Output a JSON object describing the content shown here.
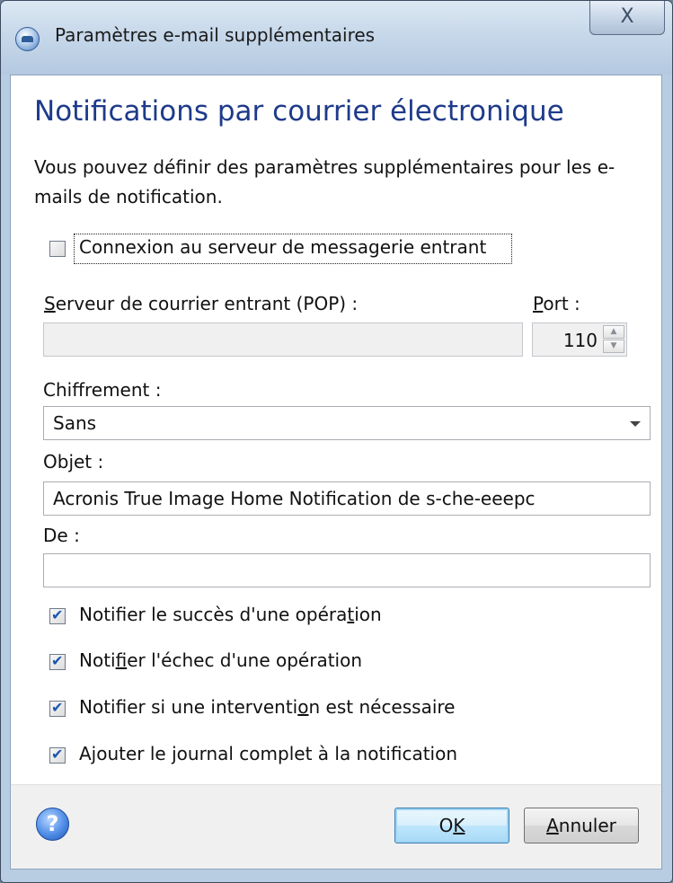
{
  "window": {
    "title": "Paramètres e-mail supplémentaires",
    "close_label": "X"
  },
  "heading": "Notifications par courrier électronique",
  "description": "Vous pouvez définir des paramètres supplémentaires pour les e-mails de notification.",
  "incoming_login": {
    "label": "Connexion au serveur de messagerie entrant",
    "checked": false
  },
  "pop": {
    "server_label_key": "S",
    "server_label_rest": "erveur de courrier entrant (POP) :",
    "server_value": "",
    "port_label_key": "P",
    "port_label_rest": "ort :",
    "port_value": "110"
  },
  "encryption": {
    "label": "Chiffrement :",
    "value": "Sans"
  },
  "subject": {
    "label": "Objet :",
    "value": "Acronis True Image Home Notification de s-che-eeepc"
  },
  "from": {
    "label": "De :",
    "value": ""
  },
  "options": [
    {
      "pre": "Notifier le succès d'une opéra",
      "key": "t",
      "post": "ion",
      "checked": true
    },
    {
      "pre": "Noti",
      "key": "f",
      "post": "ier l'échec d'une opération",
      "checked": true
    },
    {
      "pre": "Notifier si une interventi",
      "key": "o",
      "post": "n est nécessaire",
      "checked": true
    },
    {
      "pre": "Ajouter le ",
      "key": "j",
      "post": "ournal complet à la notification",
      "checked": true
    }
  ],
  "buttons": {
    "ok_pre": "O",
    "ok_key": "K",
    "cancel_key": "A",
    "cancel_rest": "nnuler"
  },
  "help_label": "?",
  "colors": {
    "heading": "#1e3a8a",
    "checkmark": "#1c56b0",
    "default_button_border": "#3c7fb1"
  }
}
